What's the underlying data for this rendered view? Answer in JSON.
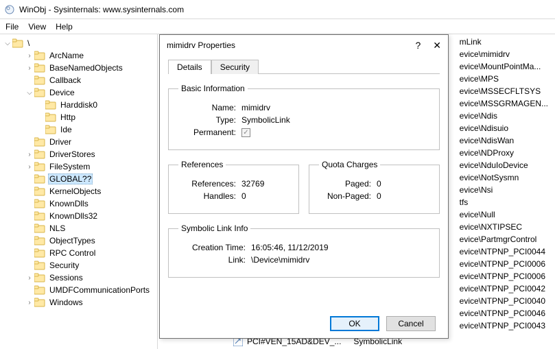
{
  "window": {
    "title": "WinObj - Sysinternals: www.sysinternals.com"
  },
  "menu": {
    "file": "File",
    "view": "View",
    "help": "Help"
  },
  "tree": {
    "root": "\\",
    "items": [
      {
        "label": "ArcName",
        "exp": "closed",
        "depth": 2
      },
      {
        "label": "BaseNamedObjects",
        "exp": "closed",
        "depth": 2
      },
      {
        "label": "Callback",
        "exp": "none",
        "depth": 2
      },
      {
        "label": "Device",
        "exp": "open",
        "depth": 2
      },
      {
        "label": "Harddisk0",
        "exp": "none",
        "depth": 3
      },
      {
        "label": "Http",
        "exp": "none",
        "depth": 3
      },
      {
        "label": "Ide",
        "exp": "none",
        "depth": 3
      },
      {
        "label": "Driver",
        "exp": "none",
        "depth": 2
      },
      {
        "label": "DriverStores",
        "exp": "closed",
        "depth": 2
      },
      {
        "label": "FileSystem",
        "exp": "closed",
        "depth": 2
      },
      {
        "label": "GLOBAL??",
        "exp": "none",
        "depth": 2,
        "selected": true
      },
      {
        "label": "KernelObjects",
        "exp": "none",
        "depth": 2
      },
      {
        "label": "KnownDlls",
        "exp": "none",
        "depth": 2
      },
      {
        "label": "KnownDlls32",
        "exp": "none",
        "depth": 2
      },
      {
        "label": "NLS",
        "exp": "none",
        "depth": 2
      },
      {
        "label": "ObjectTypes",
        "exp": "none",
        "depth": 2
      },
      {
        "label": "RPC Control",
        "exp": "none",
        "depth": 2
      },
      {
        "label": "Security",
        "exp": "none",
        "depth": 2
      },
      {
        "label": "Sessions",
        "exp": "closed",
        "depth": 2
      },
      {
        "label": "UMDFCommunicationPorts",
        "exp": "none",
        "depth": 2
      },
      {
        "label": "Windows",
        "exp": "closed",
        "depth": 2
      }
    ]
  },
  "list": {
    "visible_partial": [
      "mLink",
      "evice\\mimidrv",
      "evice\\MountPointMa...",
      "evice\\MPS",
      "evice\\MSSECFLTSYS",
      "evice\\MSSGRMAGEN...",
      "evice\\Ndis",
      "evice\\Ndisuio",
      "evice\\NdisWan",
      "evice\\NDProxy",
      "evice\\NduIoDevice",
      "evice\\NotSysmn",
      "evice\\Nsi",
      "tfs",
      "evice\\Null",
      "evice\\NXTIPSEC",
      "evice\\PartmgrControl",
      "evice\\NTPNP_PCI0044",
      "evice\\NTPNP_PCI0006",
      "evice\\NTPNP_PCI0006",
      "evice\\NTPNP_PCI0042",
      "evice\\NTPNP_PCI0040",
      "evice\\NTPNP_PCI0046",
      "evice\\NTPNP_PCI0043"
    ],
    "bottom_row": {
      "name": "PCI#VEN_15AD&DEV_...",
      "type": "SymbolicLink"
    }
  },
  "dialog": {
    "title": "mimidrv Properties",
    "help": "?",
    "close": "✕",
    "tabs": {
      "details": "Details",
      "security": "Security"
    },
    "basic": {
      "legend": "Basic Information",
      "name_label": "Name:",
      "name_value": "mimidrv",
      "type_label": "Type:",
      "type_value": "SymbolicLink",
      "permanent_label": "Permanent:",
      "permanent_checked": "✓"
    },
    "references": {
      "legend": "References",
      "references_label": "References:",
      "references_value": "32769",
      "handles_label": "Handles:",
      "handles_value": "0"
    },
    "quota": {
      "legend": "Quota Charges",
      "paged_label": "Paged:",
      "paged_value": "0",
      "nonpaged_label": "Non-Paged:",
      "nonpaged_value": "0"
    },
    "symlink": {
      "legend": "Symbolic Link Info",
      "creation_label": "Creation Time:",
      "creation_value": "16:05:46, 11/12/2019",
      "link_label": "Link:",
      "link_value": "\\Device\\mimidrv"
    },
    "buttons": {
      "ok": "OK",
      "cancel": "Cancel"
    }
  }
}
